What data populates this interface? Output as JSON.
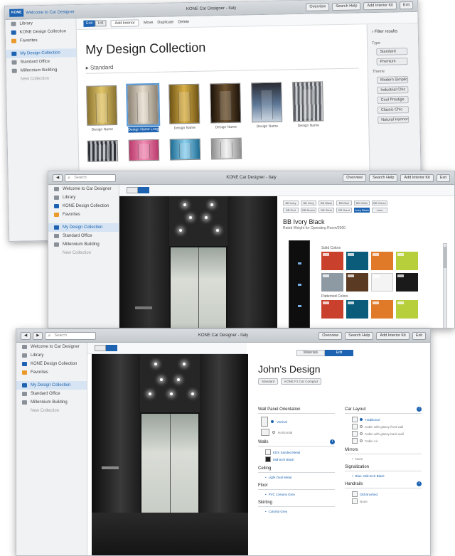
{
  "window1": {
    "app_title": "KONE Car Designer - Italy",
    "logo_text": "KONE",
    "welcome": "Welcome to Car Designer",
    "top_buttons": [
      "Overview",
      "Search Help",
      "Add Interior Kit",
      "Exit"
    ],
    "sidebar": [
      "Library",
      "KONE Design Collection",
      "Favorites",
      "My Design Collection",
      "Standard Office",
      "Millennium Building",
      "New Collection"
    ],
    "toolbar": [
      "Add Interior",
      "Move",
      "Duplicate",
      "Delete"
    ],
    "view_toggle": [
      "Grid",
      "List"
    ],
    "heading": "My Design Collection",
    "section": "Standard",
    "thumb_captions": [
      "Design Name",
      "Design Name Long Name",
      "Design Name",
      "Design Name",
      "Design Name",
      "Design Name"
    ],
    "filter": {
      "title": "Filter results",
      "group1_label": "Type",
      "group1": [
        "Standard",
        "Premium"
      ],
      "group2_label": "Theme",
      "group2": [
        "Modern Simplicity",
        "Industrial Chic",
        "Cool Prestige",
        "Classic Chic",
        "Natural Harmony"
      ]
    }
  },
  "window2": {
    "search_placeholder": "Search",
    "app_title": "KONE Car Designer - Italy",
    "top_buttons": [
      "Overview",
      "Search Help",
      "Add Interior Kit",
      "Exit"
    ],
    "sidebar": [
      "Welcome to Car Designer",
      "Library",
      "KONE Design Collection",
      "Favorites",
      "My Design Collection",
      "Standard Office",
      "Millennium Building",
      "New Collection"
    ],
    "finish_tabs": [
      "BB Ivory",
      "BB Grey",
      "BB Black",
      "BB Blue",
      "BB White",
      "BB Green",
      "BB Red",
      "BB Brown",
      "BB Steel",
      "BB Sand",
      "Ivory Black",
      "Lava"
    ],
    "finish_name": "BB Ivory Black",
    "finish_sub": "Rated Weight for Operating Room/2000",
    "swatch_titles": [
      "Solid Colors",
      "Patterned Colors"
    ]
  },
  "window3": {
    "search_placeholder": "Search",
    "app_title": "KONE Car Designer - Italy",
    "top_buttons": [
      "Overview",
      "Search Help",
      "Add Interior Kit",
      "Exit"
    ],
    "sidebar": [
      "Welcome to Car Designer",
      "Library",
      "KONE Design Collection",
      "Favorites",
      "My Design Collection",
      "Standard Office",
      "Millennium Building",
      "New Collection"
    ],
    "tabs": [
      "Materials",
      "Edit"
    ],
    "design_name": "John's Design",
    "pills": [
      "Standard",
      "KONE F1 Car Compact"
    ],
    "wall_panel_orientation": {
      "title": "Wall Panel Orientation",
      "options": [
        "Vertical",
        "Horizontal"
      ]
    },
    "car_layout": {
      "title": "Car Layout",
      "options": [
        "Traditional",
        "Cabin with glassy front wall",
        "Cabin with glassy back wall",
        "Cabin Air"
      ]
    },
    "walls": {
      "title": "Walls",
      "values": [
        "KDS Sanded Metal",
        "Mid-tech Black"
      ]
    },
    "mirrors": {
      "title": "Mirrors",
      "value": "None"
    },
    "ceiling": {
      "title": "Ceiling",
      "value": "Light Oval Metal"
    },
    "signalization": {
      "title": "Signalization",
      "value": "Blue, Mid-tech Black"
    },
    "floor": {
      "title": "Floor",
      "value": "PVC Creams Grey"
    },
    "handrails": {
      "title": "Handrails",
      "values": [
        "Old Brushed",
        "None"
      ]
    },
    "skirting": {
      "title": "Skirting",
      "value": "Colorful Grey"
    }
  },
  "colors": {
    "accent": "#1d63b1",
    "swatches_row1": [
      "#c9402c",
      "#0a5c7a",
      "#e07a28",
      "#b7cf3a"
    ],
    "swatches_row2": [
      "#8e9aa3",
      "#5b3a24",
      "#f4f4f4",
      "#1a1a1a"
    ],
    "swatches_row3": [
      "#c9402c",
      "#0a5c7a",
      "#e07a28",
      "#b7cf3a"
    ],
    "cabs": [
      "#c9a84a",
      "#d8cfbf",
      "#b8902e",
      "#3d2c17",
      "#2b3c55",
      "#9fa3a8"
    ]
  }
}
